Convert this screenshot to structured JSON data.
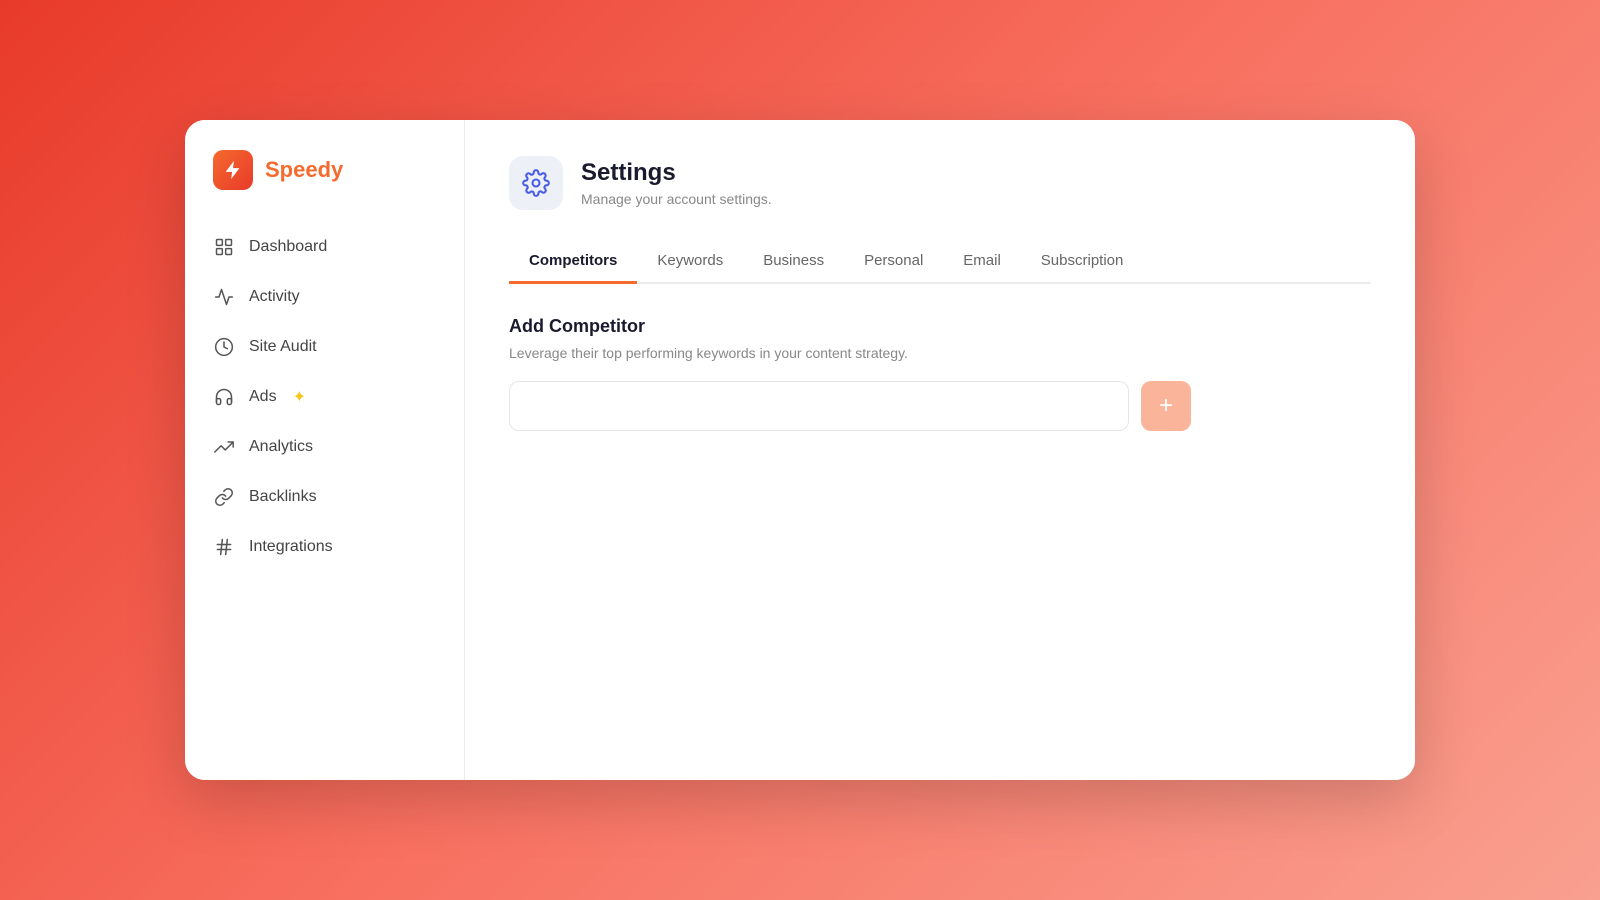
{
  "app": {
    "logo_text": "Speedy",
    "logo_icon": "🚀"
  },
  "sidebar": {
    "items": [
      {
        "id": "dashboard",
        "label": "Dashboard"
      },
      {
        "id": "activity",
        "label": "Activity"
      },
      {
        "id": "site-audit",
        "label": "Site Audit"
      },
      {
        "id": "ads",
        "label": "Ads",
        "badge": "✦"
      },
      {
        "id": "analytics",
        "label": "Analytics"
      },
      {
        "id": "backlinks",
        "label": "Backlinks"
      },
      {
        "id": "integrations",
        "label": "Integrations"
      }
    ]
  },
  "header": {
    "title": "Settings",
    "subtitle": "Manage your account settings."
  },
  "tabs": [
    {
      "id": "competitors",
      "label": "Competitors",
      "active": true
    },
    {
      "id": "keywords",
      "label": "Keywords",
      "active": false
    },
    {
      "id": "business",
      "label": "Business",
      "active": false
    },
    {
      "id": "personal",
      "label": "Personal",
      "active": false
    },
    {
      "id": "email",
      "label": "Email",
      "active": false
    },
    {
      "id": "subscription",
      "label": "Subscription",
      "active": false
    }
  ],
  "competitors_tab": {
    "section_title": "Add Competitor",
    "section_desc": "Leverage their top performing keywords in your content strategy.",
    "input_placeholder": "",
    "add_button_label": "+"
  }
}
